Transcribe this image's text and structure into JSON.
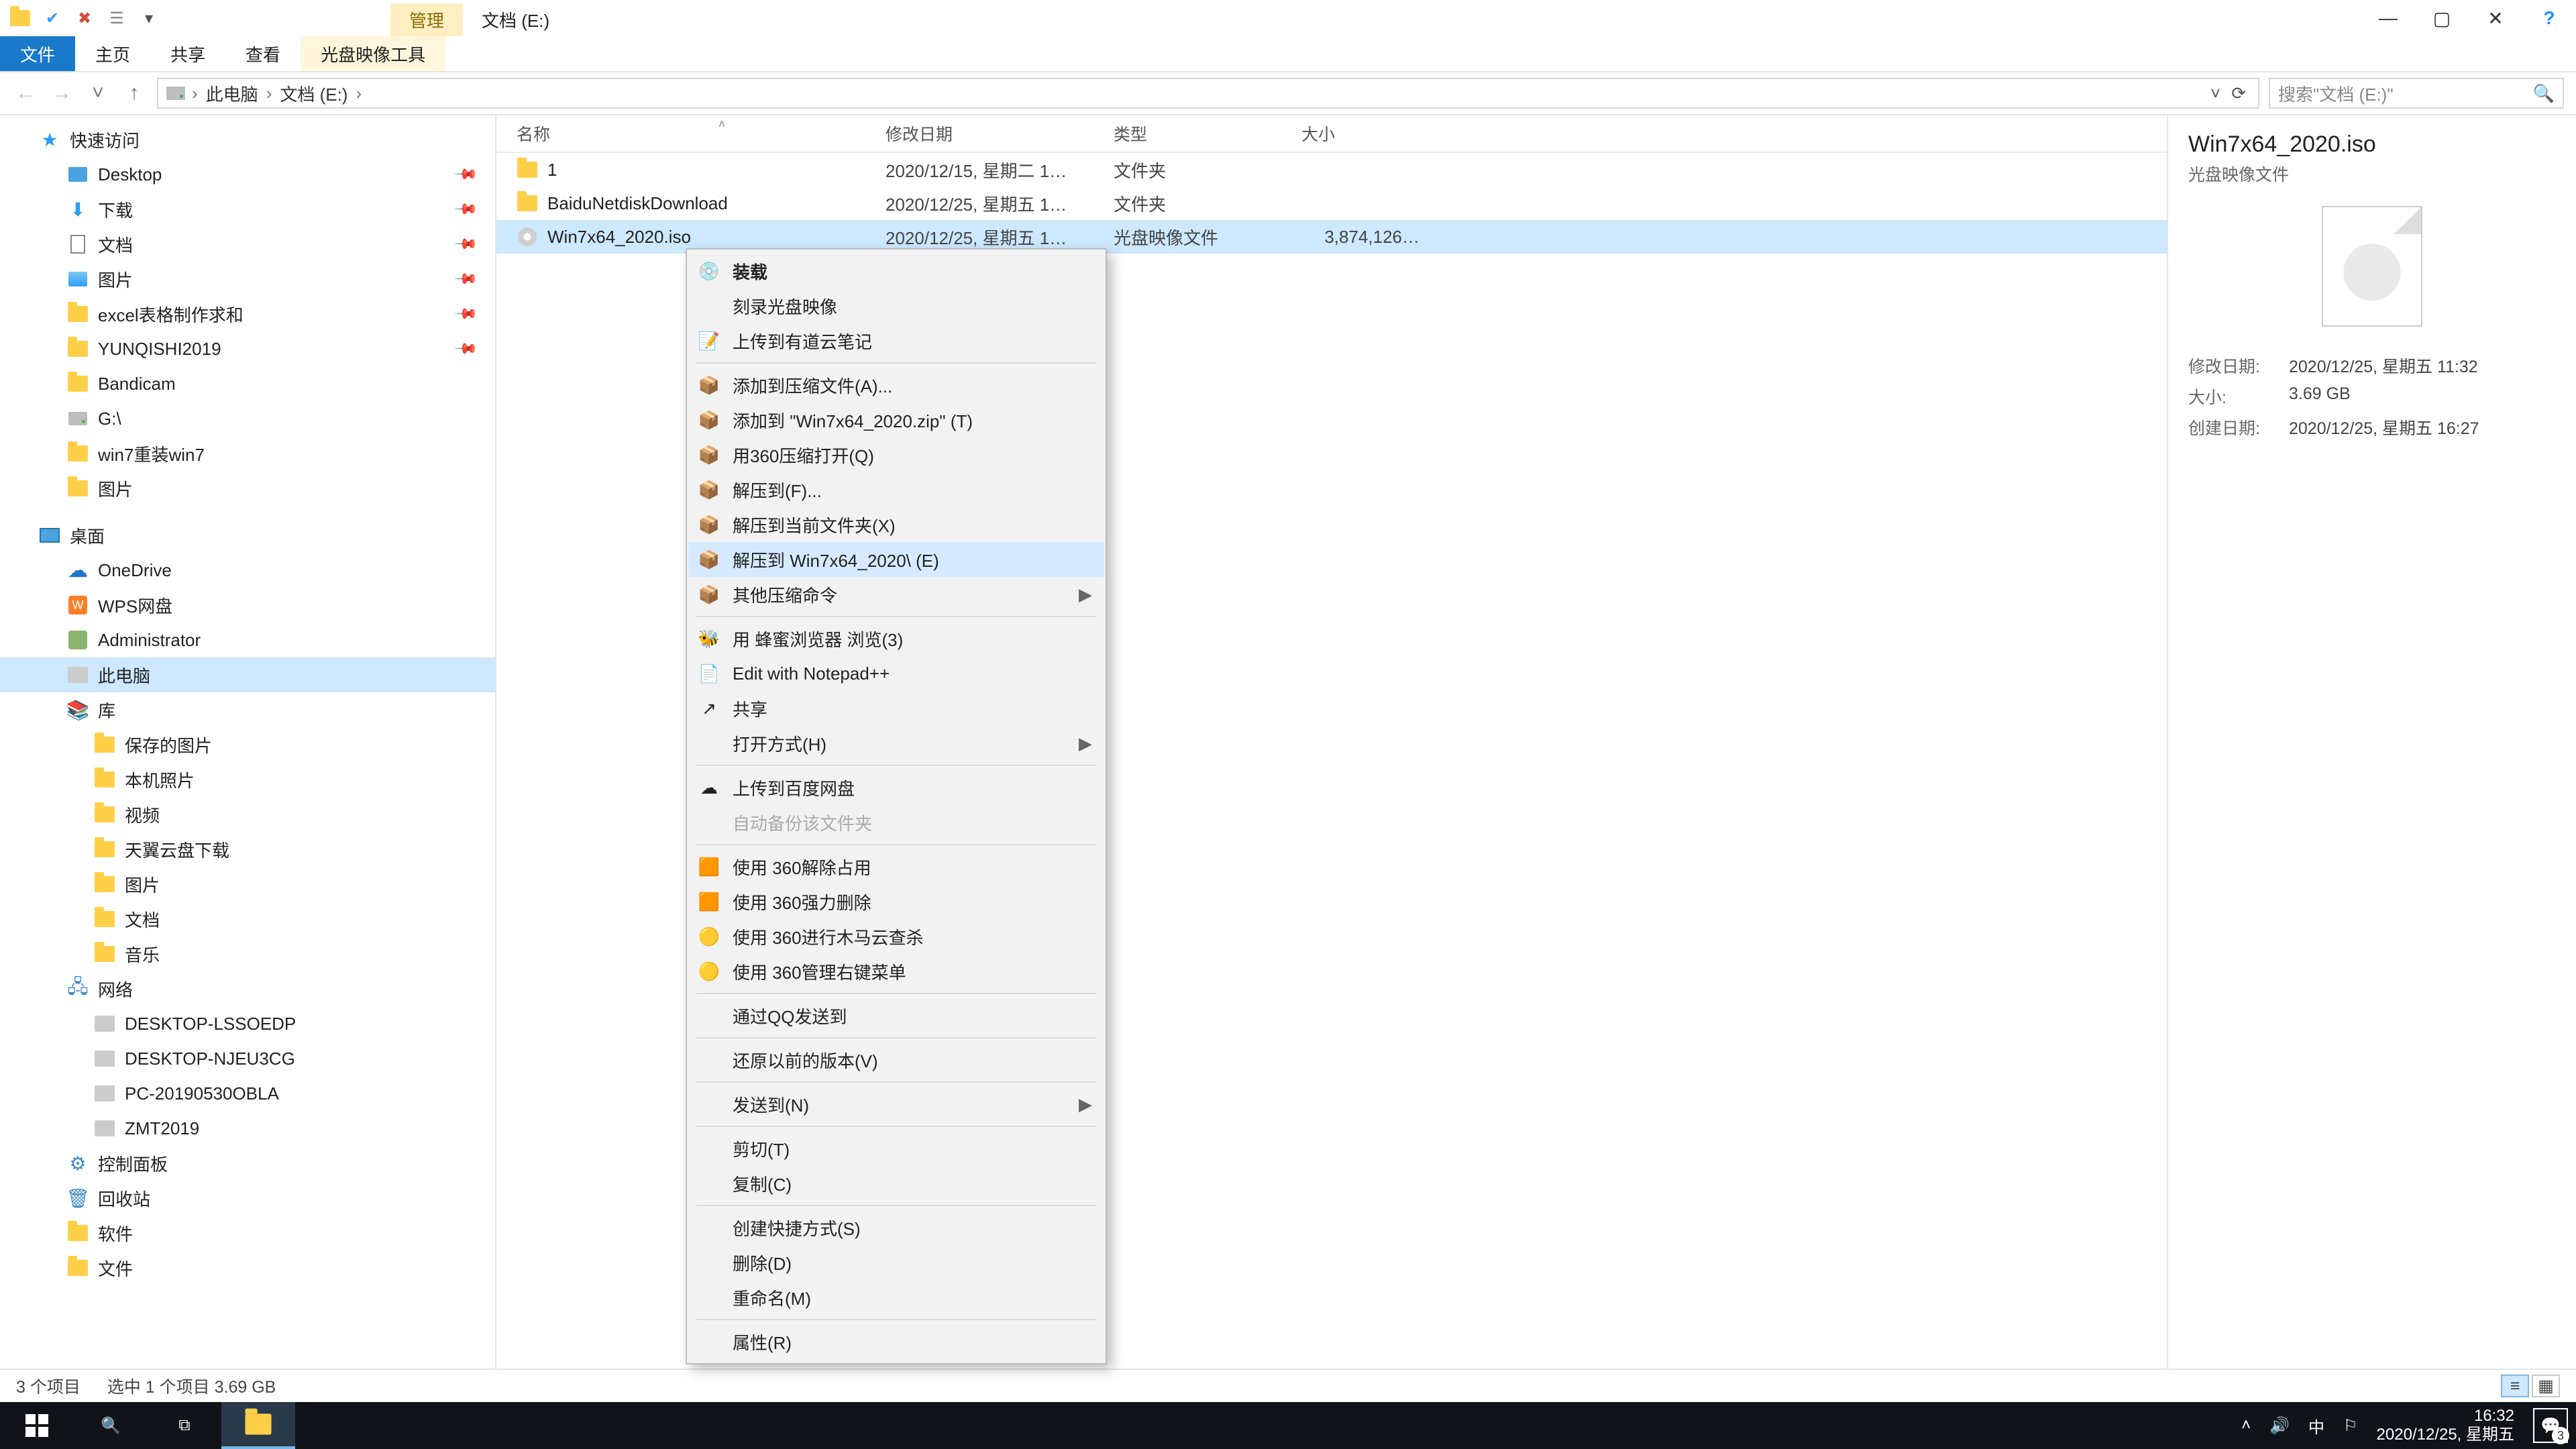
{
  "window": {
    "context_tab_group": "管理",
    "title": "文档 (E:)",
    "controls": {
      "min": "—",
      "max": "▢",
      "close": "✕",
      "help": "?"
    }
  },
  "qat": [
    "folder-icon",
    "check-icon",
    "x-icon",
    "props-icon",
    "dropdown-icon"
  ],
  "ribbon": {
    "file": "文件",
    "tabs": [
      "主页",
      "共享",
      "查看"
    ],
    "context_tab": "光盘映像工具"
  },
  "nav": {
    "back": "←",
    "fwd": "→",
    "recent": "˅",
    "up": "↑",
    "crumbs": [
      "此电脑",
      "文档 (E:)"
    ],
    "search_placeholder": "搜索\"文档 (E:)\""
  },
  "tree": [
    {
      "k": "hdr",
      "ico": "star",
      "label": "快速访问"
    },
    {
      "k": "d1",
      "ico": "desktop",
      "label": "Desktop",
      "pinned": true
    },
    {
      "k": "d1",
      "ico": "down",
      "label": "下载",
      "pinned": true
    },
    {
      "k": "d1",
      "ico": "doc",
      "label": "文档",
      "pinned": true
    },
    {
      "k": "d1",
      "ico": "pic",
      "label": "图片",
      "pinned": true
    },
    {
      "k": "d1",
      "ico": "folder",
      "label": "excel表格制作求和",
      "pinned": true
    },
    {
      "k": "d1",
      "ico": "folder",
      "label": "YUNQISHI2019",
      "pinned": true
    },
    {
      "k": "d1",
      "ico": "folder",
      "label": "Bandicam"
    },
    {
      "k": "d1",
      "ico": "drive",
      "label": "G:\\"
    },
    {
      "k": "d1",
      "ico": "folder",
      "label": "win7重装win7"
    },
    {
      "k": "d1",
      "ico": "folder",
      "label": "图片"
    },
    {
      "k": "gap"
    },
    {
      "k": "hdr",
      "ico": "mon",
      "label": "桌面"
    },
    {
      "k": "d1",
      "ico": "cloud",
      "label": "OneDrive"
    },
    {
      "k": "d1",
      "ico": "wps",
      "label": "WPS网盘"
    },
    {
      "k": "d1",
      "ico": "user",
      "label": "Administrator"
    },
    {
      "k": "d1",
      "ico": "pc",
      "label": "此电脑",
      "sel": true
    },
    {
      "k": "d1",
      "ico": "lib",
      "label": "库"
    },
    {
      "k": "d1",
      "depth": 2,
      "ico": "folder",
      "label": "保存的图片"
    },
    {
      "k": "d1",
      "depth": 2,
      "ico": "folder",
      "label": "本机照片"
    },
    {
      "k": "d1",
      "depth": 2,
      "ico": "folder",
      "label": "视频"
    },
    {
      "k": "d1",
      "depth": 2,
      "ico": "folder",
      "label": "天翼云盘下载"
    },
    {
      "k": "d1",
      "depth": 2,
      "ico": "folder",
      "label": "图片"
    },
    {
      "k": "d1",
      "depth": 2,
      "ico": "folder",
      "label": "文档"
    },
    {
      "k": "d1",
      "depth": 2,
      "ico": "folder",
      "label": "音乐"
    },
    {
      "k": "d1",
      "ico": "net",
      "label": "网络"
    },
    {
      "k": "d1",
      "depth": 2,
      "ico": "pc",
      "label": "DESKTOP-LSSOEDP"
    },
    {
      "k": "d1",
      "depth": 2,
      "ico": "pc",
      "label": "DESKTOP-NJEU3CG"
    },
    {
      "k": "d1",
      "depth": 2,
      "ico": "pc",
      "label": "PC-20190530OBLA"
    },
    {
      "k": "d1",
      "depth": 2,
      "ico": "pc",
      "label": "ZMT2019"
    },
    {
      "k": "d1",
      "ico": "cp",
      "label": "控制面板"
    },
    {
      "k": "d1",
      "ico": "bin",
      "label": "回收站"
    },
    {
      "k": "d1",
      "ico": "folder",
      "label": "软件"
    },
    {
      "k": "d1",
      "ico": "folder",
      "label": "文件"
    }
  ],
  "columns": {
    "name": "名称",
    "mod": "修改日期",
    "type": "类型",
    "size": "大小"
  },
  "rows": [
    {
      "ico": "folder",
      "name": "1",
      "mod": "2020/12/15, 星期二 1…",
      "type": "文件夹",
      "size": ""
    },
    {
      "ico": "folder",
      "name": "BaiduNetdiskDownload",
      "mod": "2020/12/25, 星期五 1…",
      "type": "文件夹",
      "size": ""
    },
    {
      "ico": "disc",
      "name": "Win7x64_2020.iso",
      "mod": "2020/12/25, 星期五 1…",
      "type": "光盘映像文件",
      "size": "3,874,126…",
      "sel": true
    }
  ],
  "context_menu": [
    {
      "t": "item",
      "ico": "disc",
      "label": "装载",
      "bold": true
    },
    {
      "t": "item",
      "label": "刻录光盘映像"
    },
    {
      "t": "item",
      "ico": "note",
      "label": "上传到有道云笔记"
    },
    {
      "t": "sep"
    },
    {
      "t": "item",
      "ico": "zip",
      "label": "添加到压缩文件(A)..."
    },
    {
      "t": "item",
      "ico": "zip",
      "label": "添加到 \"Win7x64_2020.zip\" (T)"
    },
    {
      "t": "item",
      "ico": "zip",
      "label": "用360压缩打开(Q)"
    },
    {
      "t": "item",
      "ico": "zip",
      "label": "解压到(F)..."
    },
    {
      "t": "item",
      "ico": "zip",
      "label": "解压到当前文件夹(X)"
    },
    {
      "t": "item",
      "ico": "zip",
      "label": "解压到 Win7x64_2020\\ (E)",
      "hover": true
    },
    {
      "t": "item",
      "ico": "zip",
      "label": "其他压缩命令",
      "sub": true
    },
    {
      "t": "sep"
    },
    {
      "t": "item",
      "ico": "bee",
      "label": "用 蜂蜜浏览器 浏览(3)"
    },
    {
      "t": "item",
      "ico": "npp",
      "label": "Edit with Notepad++"
    },
    {
      "t": "item",
      "ico": "share",
      "label": "共享"
    },
    {
      "t": "item",
      "label": "打开方式(H)",
      "sub": true
    },
    {
      "t": "sep"
    },
    {
      "t": "item",
      "ico": "bdy",
      "label": "上传到百度网盘"
    },
    {
      "t": "item",
      "label": "自动备份该文件夹",
      "disabled": true
    },
    {
      "t": "sep"
    },
    {
      "t": "item",
      "ico": "360",
      "label": "使用 360解除占用"
    },
    {
      "t": "item",
      "ico": "360",
      "label": "使用 360强力删除"
    },
    {
      "t": "item",
      "ico": "360g",
      "label": "使用 360进行木马云查杀"
    },
    {
      "t": "item",
      "ico": "360g",
      "label": "使用 360管理右键菜单"
    },
    {
      "t": "sep"
    },
    {
      "t": "item",
      "label": "通过QQ发送到"
    },
    {
      "t": "sep"
    },
    {
      "t": "item",
      "label": "还原以前的版本(V)"
    },
    {
      "t": "sep"
    },
    {
      "t": "item",
      "label": "发送到(N)",
      "sub": true
    },
    {
      "t": "sep"
    },
    {
      "t": "item",
      "label": "剪切(T)"
    },
    {
      "t": "item",
      "label": "复制(C)"
    },
    {
      "t": "sep"
    },
    {
      "t": "item",
      "label": "创建快捷方式(S)"
    },
    {
      "t": "item",
      "label": "删除(D)"
    },
    {
      "t": "item",
      "label": "重命名(M)"
    },
    {
      "t": "sep"
    },
    {
      "t": "item",
      "label": "属性(R)"
    }
  ],
  "preview": {
    "title": "Win7x64_2020.iso",
    "subtitle": "光盘映像文件",
    "rows": [
      {
        "k": "修改日期:",
        "v": "2020/12/25, 星期五 11:32"
      },
      {
        "k": "大小:",
        "v": "3.69 GB"
      },
      {
        "k": "创建日期:",
        "v": "2020/12/25, 星期五 16:27"
      }
    ]
  },
  "status": {
    "count": "3 个项目",
    "sel": "选中 1 个项目  3.69 GB"
  },
  "taskbar": {
    "time": "16:32",
    "date": "2020/12/25, 星期五",
    "ime": "中",
    "notif_count": "3"
  }
}
